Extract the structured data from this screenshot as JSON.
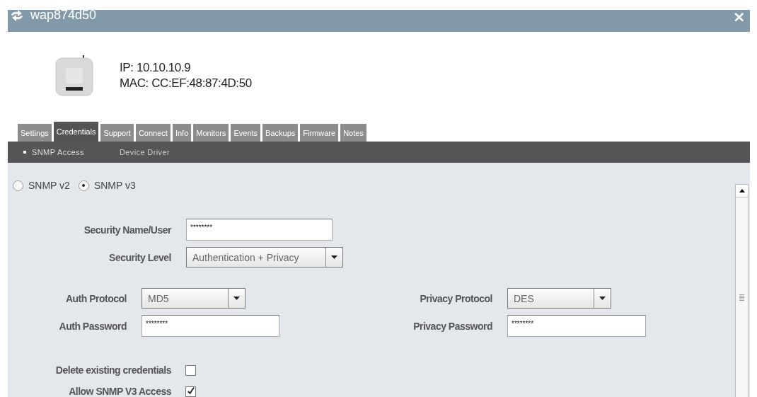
{
  "window": {
    "title": "wap874d50",
    "close": "×"
  },
  "device": {
    "ip": "IP: 10.10.10.9",
    "mac": "MAC: CC:EF:48:87:4D:50"
  },
  "tabs": [
    {
      "label": "Settings",
      "selected": false
    },
    {
      "label": "Credentials",
      "selected": true
    },
    {
      "label": "Support",
      "selected": false
    },
    {
      "label": "Connect",
      "selected": false
    },
    {
      "label": "Info",
      "selected": false
    },
    {
      "label": "Monitors",
      "selected": false
    },
    {
      "label": "Events",
      "selected": false
    },
    {
      "label": "Backups",
      "selected": false
    },
    {
      "label": "Firmware",
      "selected": false
    },
    {
      "label": "Notes",
      "selected": false
    }
  ],
  "subtabs": [
    {
      "label": "SNMP Access",
      "selected": true
    },
    {
      "label": "Device Driver",
      "selected": false
    }
  ],
  "snmp_version": [
    {
      "label": "SNMP v2",
      "selected": false
    },
    {
      "label": "SNMP v3",
      "selected": true
    }
  ],
  "security_name": {
    "label": "Security Name/User",
    "value": "********"
  },
  "security_level": {
    "label": "Security Level",
    "value": "Authentication + Privacy"
  },
  "auth_protocol": {
    "label": "Auth Protocol",
    "value": "MD5"
  },
  "privacy_protocol": {
    "label": "Privacy Protocol",
    "value": "DES"
  },
  "auth_password": {
    "label": "Auth Password",
    "value": "********"
  },
  "privacy_password": {
    "label": "Privacy Password",
    "value": "********"
  },
  "checkboxes": [
    {
      "label": "Delete existing credentials",
      "checked": false
    },
    {
      "label": "Allow SNMP V3 Access",
      "checked": true
    }
  ]
}
